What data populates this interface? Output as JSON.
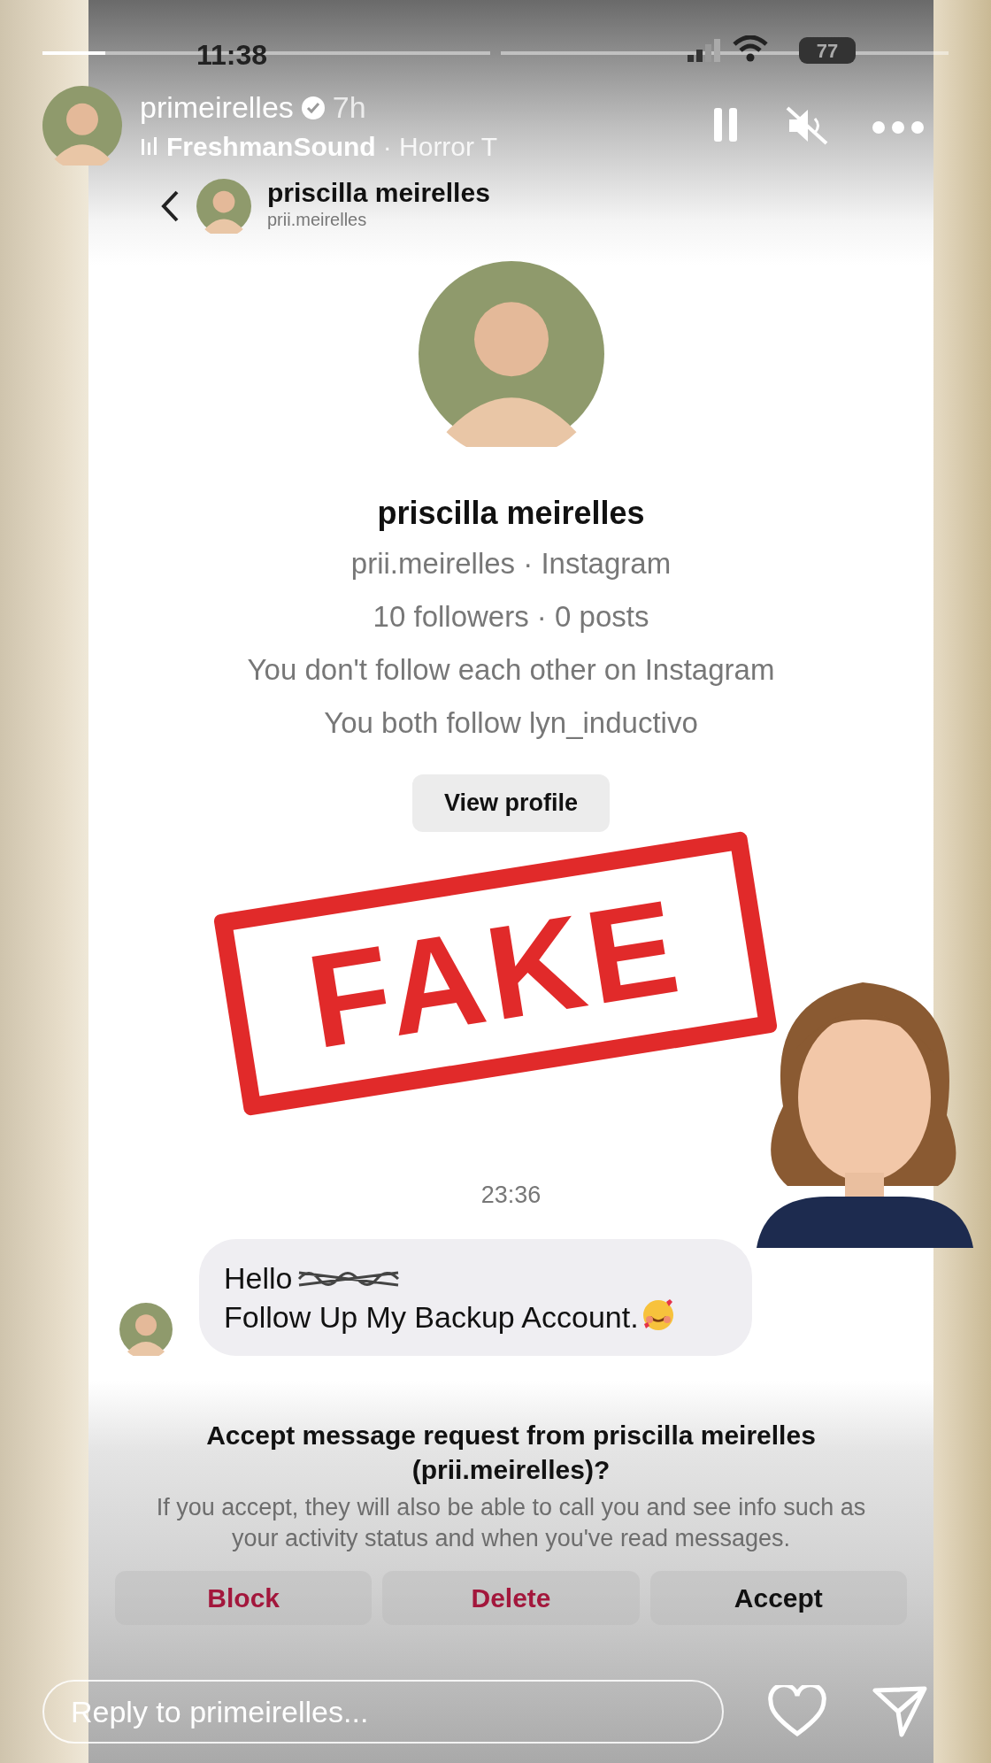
{
  "status_bar": {
    "time": "11:38",
    "battery": "77"
  },
  "story_progress": [
    {
      "level": 0.14
    },
    {
      "level": 0
    }
  ],
  "story_header": {
    "username": "primeirelles",
    "verified": true,
    "age": "7h",
    "artist": "FreshmanSound",
    "track": "· Horror T"
  },
  "dm_header": {
    "name": "priscilla meirelles",
    "username": "prii.meirelles"
  },
  "profile": {
    "name": "priscilla meirelles",
    "lines": [
      "prii.meirelles · Instagram",
      "10 followers · 0 posts",
      "You don't follow each other on Instagram",
      "You both follow lyn_inductivo"
    ],
    "button": "View profile"
  },
  "stamp": "FAKE",
  "timestamp": "23:36",
  "message": {
    "before": "Hello",
    "redacted": true,
    "after": "Follow Up My Backup Account."
  },
  "request": {
    "title": "Accept message request from priscilla meirelles (prii.meirelles)?",
    "body": "If you accept, they will also be able to call you and see info such as your activity status and when you've read messages.",
    "buttons": [
      {
        "label": "Block",
        "kind": "danger"
      },
      {
        "label": "Delete",
        "kind": "danger"
      },
      {
        "label": "Accept",
        "kind": "primary"
      }
    ]
  },
  "reply": {
    "placeholder": "Reply to primeirelles..."
  }
}
